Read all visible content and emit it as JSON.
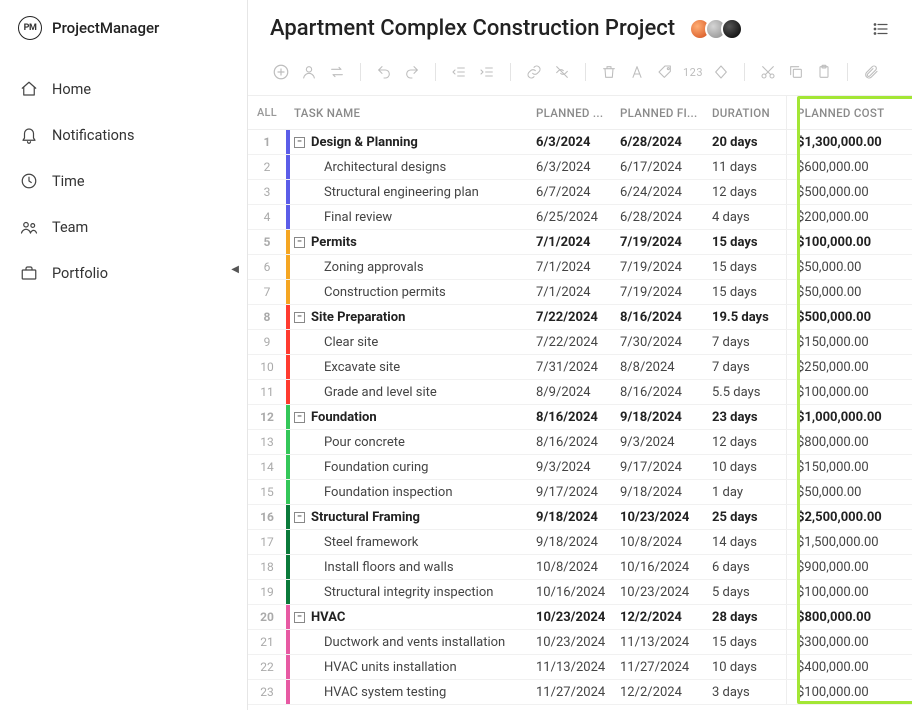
{
  "app": {
    "logo_letters": "PM",
    "logo_name": "ProjectManager"
  },
  "nav": {
    "home": "Home",
    "notifications": "Notifications",
    "time": "Time",
    "team": "Team",
    "portfolio": "Portfolio"
  },
  "header": {
    "title": "Apartment Complex Construction Project"
  },
  "columns": {
    "all": "ALL",
    "task": "TASK NAME",
    "start": "PLANNED ...",
    "finish": "PLANNED FI...",
    "duration": "DURATION",
    "cost": "PLANNED COST"
  },
  "rows": [
    {
      "n": "1",
      "type": "summary",
      "color": "#5b5de8",
      "name": "Design & Planning",
      "start": "6/3/2024",
      "finish": "6/28/2024",
      "dur": "20 days",
      "cost": "$1,300,000.00"
    },
    {
      "n": "2",
      "type": "child",
      "color": "#5b5de8",
      "name": "Architectural designs",
      "start": "6/3/2024",
      "finish": "6/17/2024",
      "dur": "11 days",
      "cost": "$600,000.00"
    },
    {
      "n": "3",
      "type": "child",
      "color": "#5b5de8",
      "name": "Structural engineering plan",
      "start": "6/7/2024",
      "finish": "6/24/2024",
      "dur": "12 days",
      "cost": "$500,000.00"
    },
    {
      "n": "4",
      "type": "child",
      "color": "#5b5de8",
      "name": "Final review",
      "start": "6/25/2024",
      "finish": "6/28/2024",
      "dur": "4 days",
      "cost": "$200,000.00"
    },
    {
      "n": "5",
      "type": "summary",
      "color": "#f5a623",
      "name": "Permits",
      "start": "7/1/2024",
      "finish": "7/19/2024",
      "dur": "15 days",
      "cost": "$100,000.00"
    },
    {
      "n": "6",
      "type": "child",
      "color": "#f5a623",
      "name": "Zoning approvals",
      "start": "7/1/2024",
      "finish": "7/19/2024",
      "dur": "15 days",
      "cost": "$50,000.00"
    },
    {
      "n": "7",
      "type": "child",
      "color": "#f5a623",
      "name": "Construction permits",
      "start": "7/1/2024",
      "finish": "7/19/2024",
      "dur": "15 days",
      "cost": "$50,000.00"
    },
    {
      "n": "8",
      "type": "summary",
      "color": "#ff3b30",
      "name": "Site Preparation",
      "start": "7/22/2024",
      "finish": "8/16/2024",
      "dur": "19.5 days",
      "cost": "$500,000.00"
    },
    {
      "n": "9",
      "type": "child",
      "color": "#ff3b30",
      "name": "Clear site",
      "start": "7/22/2024",
      "finish": "7/30/2024",
      "dur": "7 days",
      "cost": "$150,000.00"
    },
    {
      "n": "10",
      "type": "child",
      "color": "#ff3b30",
      "name": "Excavate site",
      "start": "7/31/2024",
      "finish": "8/8/2024",
      "dur": "7 days",
      "cost": "$250,000.00"
    },
    {
      "n": "11",
      "type": "child",
      "color": "#ff3b30",
      "name": "Grade and level site",
      "start": "8/9/2024",
      "finish": "8/16/2024",
      "dur": "5.5 days",
      "cost": "$100,000.00"
    },
    {
      "n": "12",
      "type": "summary",
      "color": "#34c759",
      "name": "Foundation",
      "start": "8/16/2024",
      "finish": "9/18/2024",
      "dur": "23 days",
      "cost": "$1,000,000.00"
    },
    {
      "n": "13",
      "type": "child",
      "color": "#34c759",
      "name": "Pour concrete",
      "start": "8/16/2024",
      "finish": "9/3/2024",
      "dur": "12 days",
      "cost": "$800,000.00"
    },
    {
      "n": "14",
      "type": "child",
      "color": "#34c759",
      "name": "Foundation curing",
      "start": "9/3/2024",
      "finish": "9/17/2024",
      "dur": "10 days",
      "cost": "$150,000.00"
    },
    {
      "n": "15",
      "type": "child",
      "color": "#34c759",
      "name": "Foundation inspection",
      "start": "9/17/2024",
      "finish": "9/18/2024",
      "dur": "1 day",
      "cost": "$50,000.00"
    },
    {
      "n": "16",
      "type": "summary",
      "color": "#0a7a3a",
      "name": "Structural Framing",
      "start": "9/18/2024",
      "finish": "10/23/2024",
      "dur": "25 days",
      "cost": "$2,500,000.00"
    },
    {
      "n": "17",
      "type": "child",
      "color": "#0a7a3a",
      "name": "Steel framework",
      "start": "9/18/2024",
      "finish": "10/8/2024",
      "dur": "14 days",
      "cost": "$1,500,000.00"
    },
    {
      "n": "18",
      "type": "child",
      "color": "#0a7a3a",
      "name": "Install floors and walls",
      "start": "10/8/2024",
      "finish": "10/16/2024",
      "dur": "6 days",
      "cost": "$900,000.00"
    },
    {
      "n": "19",
      "type": "child",
      "color": "#0a7a3a",
      "name": "Structural integrity inspection",
      "start": "10/16/2024",
      "finish": "10/23/2024",
      "dur": "5 days",
      "cost": "$100,000.00"
    },
    {
      "n": "20",
      "type": "summary",
      "color": "#e75aa3",
      "name": "HVAC",
      "start": "10/23/2024",
      "finish": "12/2/2024",
      "dur": "28 days",
      "cost": "$800,000.00"
    },
    {
      "n": "21",
      "type": "child",
      "color": "#e75aa3",
      "name": "Ductwork and vents installation",
      "start": "10/23/2024",
      "finish": "11/13/2024",
      "dur": "15 days",
      "cost": "$300,000.00"
    },
    {
      "n": "22",
      "type": "child",
      "color": "#e75aa3",
      "name": "HVAC units installation",
      "start": "11/13/2024",
      "finish": "11/27/2024",
      "dur": "10 days",
      "cost": "$400,000.00"
    },
    {
      "n": "23",
      "type": "child",
      "color": "#e75aa3",
      "name": "HVAC system testing",
      "start": "11/27/2024",
      "finish": "12/2/2024",
      "dur": "3 days",
      "cost": "$100,000.00"
    }
  ]
}
